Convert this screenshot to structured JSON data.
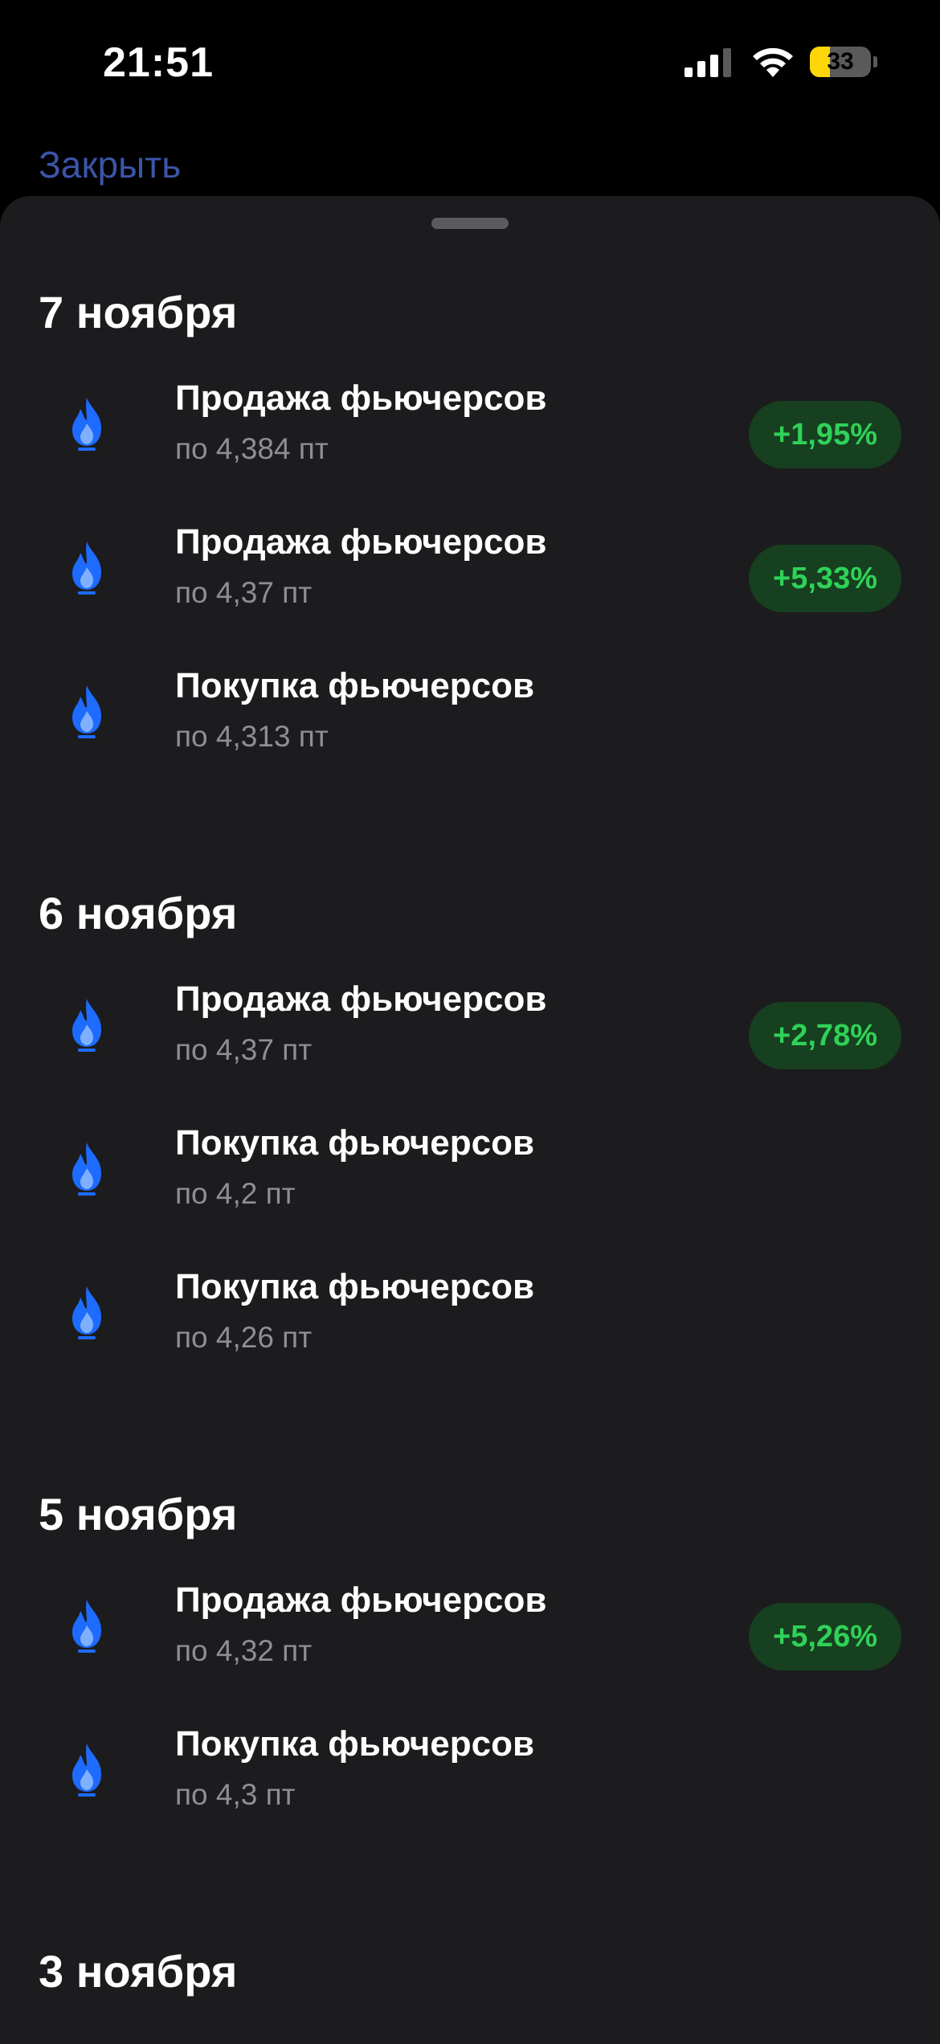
{
  "status_bar": {
    "time": "21:51",
    "battery": "33",
    "battery_level": 0.33
  },
  "nav": {
    "close_label": "Закрыть"
  },
  "colors": {
    "accent_link": "#3b55a6",
    "badge_bg": "#16401f",
    "badge_text": "#30d158",
    "flame_icon": "#1e6bff",
    "sheet_bg": "#1c1c1e"
  },
  "sections": [
    {
      "date": "7 ноября",
      "items": [
        {
          "icon": "gas-flame-icon",
          "title": "Продажа фьючерсов",
          "subtitle": "по 4,384 пт",
          "badge": "+1,95%"
        },
        {
          "icon": "gas-flame-icon",
          "title": "Продажа фьючерсов",
          "subtitle": "по 4,37 пт",
          "badge": "+5,33%"
        },
        {
          "icon": "gas-flame-icon",
          "title": "Покупка фьючерсов",
          "subtitle": "по 4,313 пт",
          "badge": null
        }
      ]
    },
    {
      "date": "6 ноября",
      "items": [
        {
          "icon": "gas-flame-icon",
          "title": "Продажа фьючерсов",
          "subtitle": "по 4,37 пт",
          "badge": "+2,78%"
        },
        {
          "icon": "gas-flame-icon",
          "title": "Покупка фьючерсов",
          "subtitle": "по 4,2 пт",
          "badge": null
        },
        {
          "icon": "gas-flame-icon",
          "title": "Покупка фьючерсов",
          "subtitle": "по 4,26 пт",
          "badge": null
        }
      ]
    },
    {
      "date": "5 ноября",
      "items": [
        {
          "icon": "gas-flame-icon",
          "title": "Продажа фьючерсов",
          "subtitle": "по 4,32 пт",
          "badge": "+5,26%"
        },
        {
          "icon": "gas-flame-icon",
          "title": "Покупка фьючерсов",
          "subtitle": "по 4,3 пт",
          "badge": null
        }
      ]
    },
    {
      "date": "3 ноября",
      "items": []
    }
  ]
}
